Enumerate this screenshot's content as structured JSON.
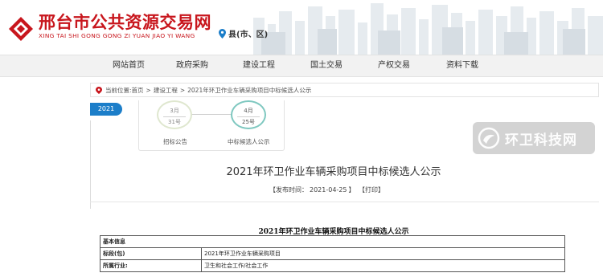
{
  "header": {
    "site_title": "邢台市公共资源交易网",
    "site_subtitle": "XING TAI SHI GONG GONG ZI YUAN JIAO YI WANG",
    "location_label": "县(市、区)",
    "brand_color": "#c8161d"
  },
  "nav": {
    "items": [
      {
        "label": "网站首页"
      },
      {
        "label": "政府采购"
      },
      {
        "label": "建设工程"
      },
      {
        "label": "国土交易"
      },
      {
        "label": "产权交易"
      },
      {
        "label": "资料下载"
      }
    ]
  },
  "breadcrumb": {
    "prefix": "当前位置:",
    "items": [
      "首页",
      "建设工程",
      "2021年环卫作业车辆采购项目中标候选人公示"
    ],
    "separator": ">"
  },
  "year_tab": {
    "label": "2021",
    "color": "#1c7ec9"
  },
  "timeline": {
    "steps": [
      {
        "month": "3月",
        "day": "31号",
        "label": "招标公告"
      },
      {
        "month": "4月",
        "day": "25号",
        "label": "中标候选人公示"
      }
    ]
  },
  "watermark": {
    "text": "环卫科技网"
  },
  "article": {
    "title": "2021年环卫作业车辆采购项目中标候选人公示",
    "publish_prefix": "【发布时间：",
    "publish_date": "2021-04-25",
    "publish_suffix": "】",
    "print_label": "【打印】"
  },
  "document": {
    "heading": "2021年环卫作业车辆采购项目中标候选人公示",
    "section_label": "基本信息",
    "rows": [
      {
        "label": "标段(包)",
        "value": "2021年环卫作业车辆采购项目"
      },
      {
        "label": "所属行业:",
        "value": "卫生和社会工作/社会工作"
      }
    ]
  }
}
